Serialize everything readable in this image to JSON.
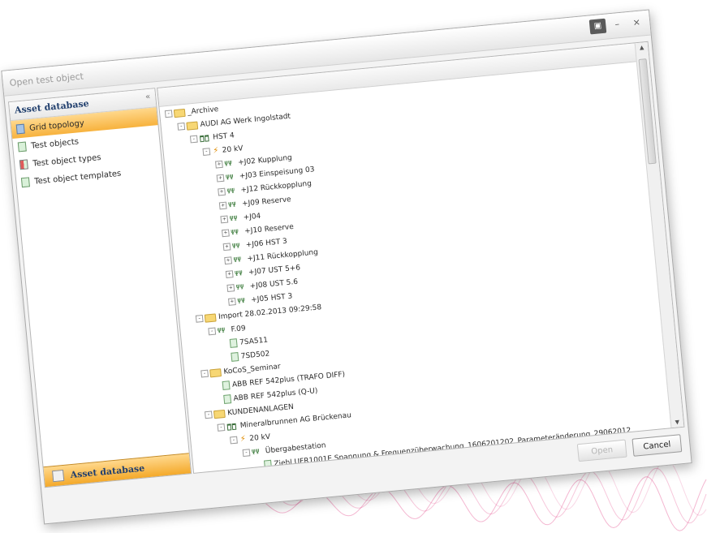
{
  "window": {
    "title": "Open test object",
    "controls": {
      "maximize": "▣",
      "minimize": "–",
      "close": "×"
    }
  },
  "left_panel": {
    "title": "Asset database",
    "collapse_icon": "«",
    "items": [
      {
        "label": "Grid topology",
        "icon": "grid-icon",
        "active": true
      },
      {
        "label": "Test objects",
        "icon": "test-object-icon",
        "active": false
      },
      {
        "label": "Test object types",
        "icon": "test-object-type-icon",
        "active": false
      },
      {
        "label": "Test object templates",
        "icon": "test-object-template-icon",
        "active": false
      }
    ],
    "footer_label": "Asset database"
  },
  "tree": {
    "rows": [
      {
        "label": "_Archive",
        "type": "folder",
        "depth": 0,
        "expander": "-"
      },
      {
        "label": "AUDI AG Werk Ingolstadt",
        "type": "folder",
        "depth": 1,
        "expander": "-"
      },
      {
        "label": "HST 4",
        "type": "station",
        "depth": 2,
        "expander": "-"
      },
      {
        "label": "20 kV",
        "type": "voltage",
        "depth": 3,
        "expander": "-"
      },
      {
        "label": "+J02 Kupplung",
        "type": "bay",
        "depth": 4,
        "expander": "+"
      },
      {
        "label": "+J03 Einspeisung 03",
        "type": "bay",
        "depth": 4,
        "expander": "+"
      },
      {
        "label": "+J12 Rückkopplung",
        "type": "bay",
        "depth": 4,
        "expander": "+"
      },
      {
        "label": "+J09 Reserve",
        "type": "bay",
        "depth": 4,
        "expander": "+"
      },
      {
        "label": "+J04",
        "type": "bay",
        "depth": 4,
        "expander": "+"
      },
      {
        "label": "+J10 Reserve",
        "type": "bay",
        "depth": 4,
        "expander": "+"
      },
      {
        "label": "+J06 HST 3",
        "type": "bay",
        "depth": 4,
        "expander": "+"
      },
      {
        "label": "+J11 Rückkopplung",
        "type": "bay",
        "depth": 4,
        "expander": "+"
      },
      {
        "label": "+J07 UST 5+6",
        "type": "bay",
        "depth": 4,
        "expander": "+"
      },
      {
        "label": "+J08 UST 5.6",
        "type": "bay",
        "depth": 4,
        "expander": "+"
      },
      {
        "label": "+J05 HST 3",
        "type": "bay",
        "depth": 4,
        "expander": "+"
      },
      {
        "label": "Import 28.02.2013 09:29:58",
        "type": "folder",
        "depth": 1,
        "expander": "-"
      },
      {
        "label": "F.09",
        "type": "bay",
        "depth": 2,
        "expander": "-"
      },
      {
        "label": "7SA511",
        "type": "device",
        "depth": 3,
        "expander": ""
      },
      {
        "label": "7SD502",
        "type": "device",
        "depth": 3,
        "expander": ""
      },
      {
        "label": "KoCoS_Seminar",
        "type": "folder",
        "depth": 1,
        "expander": "-"
      },
      {
        "label": "ABB REF 542plus (TRAFO DIFF)",
        "type": "device",
        "depth": 2,
        "expander": ""
      },
      {
        "label": "ABB REF 542plus (Q-U)",
        "type": "device",
        "depth": 2,
        "expander": ""
      },
      {
        "label": "KUNDENANLAGEN",
        "type": "folder",
        "depth": 1,
        "expander": "-"
      },
      {
        "label": "Mineralbrunnen AG Brückenau",
        "type": "station",
        "depth": 2,
        "expander": "-"
      },
      {
        "label": "20 kV",
        "type": "voltage",
        "depth": 3,
        "expander": "-"
      },
      {
        "label": "Übergabestation",
        "type": "bay",
        "depth": 4,
        "expander": "-"
      },
      {
        "label": "Ziehl UFR1001E Spannung & Frequenzüberwachung_1606201202_Parameteränderung_29062012",
        "type": "device",
        "depth": 5,
        "expander": ""
      }
    ]
  },
  "buttons": {
    "open_label": "Open",
    "cancel_label": "Cancel"
  },
  "colors": {
    "accent_orange": "#f7b23d",
    "header_blue": "#22406e",
    "decoration_sine": "#e0307a"
  }
}
